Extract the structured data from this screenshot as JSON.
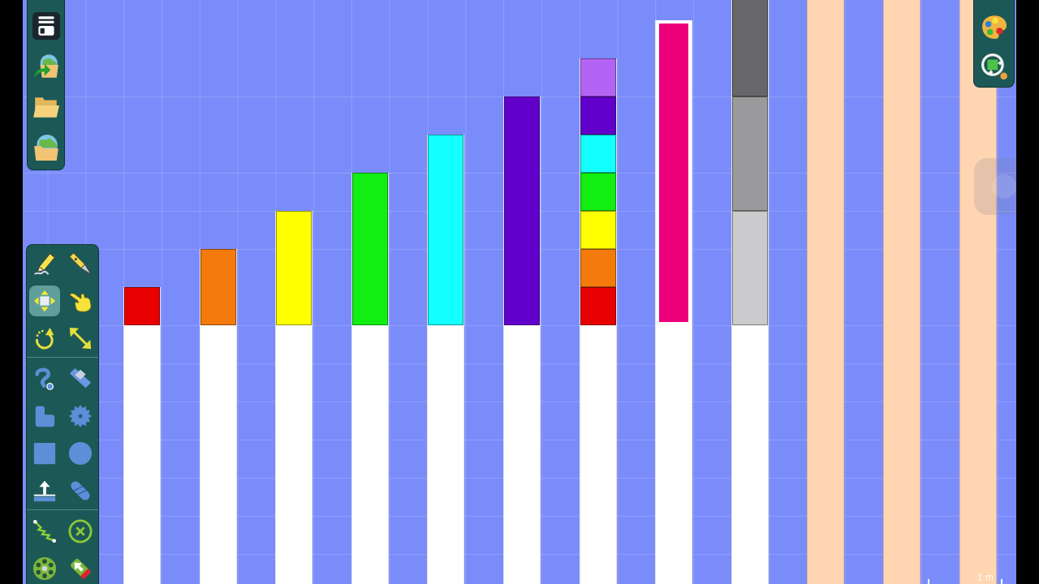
{
  "file_toolbar": {
    "buttons": [
      {
        "kind": "menu"
      },
      {
        "kind": "open"
      },
      {
        "kind": "folder"
      },
      {
        "kind": "browse"
      }
    ]
  },
  "tool_palette": {
    "groups": [
      {
        "tools": [
          {
            "kind": "sketch",
            "selected": false
          },
          {
            "kind": "knife",
            "selected": false
          },
          {
            "kind": "move",
            "selected": true
          },
          {
            "kind": "drag",
            "selected": false
          },
          {
            "kind": "rotate",
            "selected": false
          },
          {
            "kind": "scale",
            "selected": false
          }
        ]
      },
      {
        "tools": [
          {
            "kind": "rope",
            "selected": false
          },
          {
            "kind": "eraser",
            "selected": false
          },
          {
            "kind": "polygon",
            "selected": false
          },
          {
            "kind": "gear",
            "selected": false
          },
          {
            "kind": "box",
            "selected": false
          },
          {
            "kind": "circle",
            "selected": false
          },
          {
            "kind": "plane",
            "selected": false
          },
          {
            "kind": "chain",
            "selected": false
          }
        ]
      },
      {
        "tools": [
          {
            "kind": "spring",
            "selected": false
          },
          {
            "kind": "fixate",
            "selected": false
          },
          {
            "kind": "axle",
            "selected": false
          },
          {
            "kind": "tracer",
            "selected": false
          }
        ]
      }
    ]
  },
  "view_toolbar": {
    "buttons": [
      {
        "kind": "palette"
      },
      {
        "kind": "zoom"
      }
    ]
  },
  "scene": {
    "bars": [
      {
        "kind": "stack",
        "selected": false,
        "cells": [
          {
            "color": "#e80000"
          }
        ]
      },
      {
        "kind": "stack",
        "selected": false,
        "cells": [
          {
            "color": "#f47a0c"
          },
          {
            "color": "#f47a0c"
          }
        ]
      },
      {
        "kind": "stack",
        "selected": false,
        "cells": [
          {
            "color": "#ffff00"
          },
          {
            "color": "#ffff00"
          },
          {
            "color": "#ffff00"
          }
        ]
      },
      {
        "kind": "stack",
        "selected": false,
        "cells": [
          {
            "color": "#12ee12"
          },
          {
            "color": "#12ee12"
          },
          {
            "color": "#12ee12"
          },
          {
            "color": "#12ee12"
          }
        ]
      },
      {
        "kind": "stack",
        "selected": false,
        "cells": [
          {
            "color": "#14ffff"
          },
          {
            "color": "#14ffff"
          },
          {
            "color": "#14ffff"
          },
          {
            "color": "#14ffff"
          },
          {
            "color": "#14ffff"
          }
        ]
      },
      {
        "kind": "stack",
        "selected": false,
        "cells": [
          {
            "color": "#6100cb"
          },
          {
            "color": "#6100cb"
          },
          {
            "color": "#6100cb"
          },
          {
            "color": "#6100cb"
          },
          {
            "color": "#6100cb"
          },
          {
            "color": "#6100cb"
          }
        ]
      },
      {
        "kind": "stack",
        "selected": false,
        "cells": [
          {
            "color": "#e80000"
          },
          {
            "color": "#f47a0c"
          },
          {
            "color": "#ffff00"
          },
          {
            "color": "#12ee12"
          },
          {
            "color": "#14ffff"
          },
          {
            "color": "#6100cb"
          },
          {
            "color": "#b464f4"
          }
        ]
      },
      {
        "kind": "stack",
        "selected": true,
        "cells": [
          {
            "color": "#eb007a"
          },
          {
            "color": "#eb007a"
          },
          {
            "color": "#eb007a"
          },
          {
            "color": "#eb007a"
          },
          {
            "color": "#eb007a"
          },
          {
            "color": "#eb007a"
          },
          {
            "color": "#eb007a"
          },
          {
            "color": "#eb007a"
          }
        ]
      },
      {
        "kind": "stack",
        "selected": false,
        "cells": [
          {
            "color": "#cbcacc"
          },
          {
            "color": "#cbcacc"
          },
          {
            "color": "#cbcacc"
          },
          {
            "color": "#9a999b"
          },
          {
            "color": "#9a999b"
          },
          {
            "color": "#9a999b"
          },
          {
            "color": "#676668"
          },
          {
            "color": "#676668"
          },
          {
            "color": "#676668"
          }
        ]
      },
      {
        "kind": "post"
      },
      {
        "kind": "post"
      },
      {
        "kind": "post"
      }
    ],
    "scale_label": "1 m"
  }
}
